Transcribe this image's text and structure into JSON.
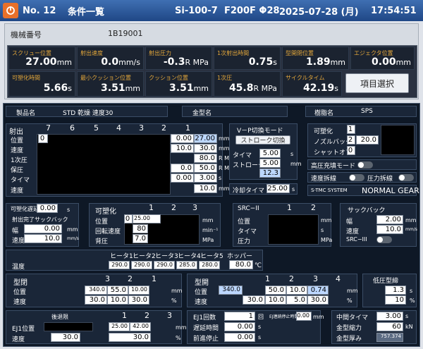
{
  "header": {
    "no": "No. 12",
    "title": "条件一覧",
    "mold": "Si-100-7",
    "spec": "F200F Φ28",
    "date": "2025-07-28 (月)",
    "time": "17:54:51"
  },
  "machine": {
    "label": "機械番号",
    "value": "1B19001"
  },
  "monitor": [
    {
      "label": "スクリュー位置",
      "value": "27.00",
      "unit": "mm"
    },
    {
      "label": "射出速度",
      "value": "0.0",
      "unit": "mm/s"
    },
    {
      "label": "射出圧力",
      "value": "-0.3",
      "unit": "R MPa"
    },
    {
      "label": "1次射出時間",
      "value": "0.75",
      "unit": "s"
    },
    {
      "label": "型開閉位置",
      "value": "1.89",
      "unit": "mm"
    },
    {
      "label": "エジェクタ位置",
      "value": "0.00",
      "unit": "mm"
    },
    {
      "label": "可塑化時間",
      "value": "5.66",
      "unit": "s"
    },
    {
      "label": "最小クッション位置",
      "value": "3.51",
      "unit": "mm"
    },
    {
      "label": "クッション位置",
      "value": "3.51",
      "unit": "mm"
    },
    {
      "label": "1次圧",
      "value": "45.8",
      "unit": "R MPa"
    },
    {
      "label": "サイクルタイム",
      "value": "42.19",
      "unit": "s"
    }
  ],
  "select_button": "項目選択",
  "info": {
    "product_label": "製品名",
    "product_value": "STD 乾燥  速度30",
    "mold_label": "金型名",
    "mold_value": "",
    "resin_label": "樹脂名",
    "resin_value": "SPS"
  },
  "inject": {
    "title": "射出",
    "cols": [
      "7",
      "6",
      "5",
      "4",
      "3",
      "2",
      "1"
    ],
    "rows": [
      "位置",
      "速度",
      "1次圧",
      "保圧",
      "タイマ",
      "速度"
    ],
    "pos0": "0",
    "pos2": "0.00",
    "pos1": "27.00",
    "spd2": "10.0",
    "spd1": "30.0",
    "p1": "80.0",
    "h2": "0.0",
    "h1": "50.0",
    "t2": "0.00",
    "t1": "3.00",
    "v1": "10.0",
    "units": [
      "mm",
      "mm/s",
      "R MPa",
      "R MPa",
      "s",
      "mm/s"
    ]
  },
  "vp": {
    "title": "V－P切換モード",
    "mode": "ストローク切換",
    "timer_label": "タイマ",
    "timer": "5.00",
    "timer_unit": "s",
    "stroke_label": "ストローク",
    "stroke": "5.00",
    "stroke_unit": "mm",
    "extra": "12.3"
  },
  "cool": {
    "label": "冷却タイマ",
    "value": "25.00",
    "unit": "s"
  },
  "plast": {
    "rows": [
      "可塑化",
      "ノズルバック",
      "シャットオフ"
    ],
    "vals": [
      "1",
      "2",
      "0"
    ],
    "mid": "20.0",
    "high_label": "高圧充填モード",
    "high_state": "OFF",
    "spd_label": "速度拆線",
    "spd_state": "OFF",
    "prs_label": "圧力拆線",
    "prs_state": "OFF",
    "tmc_label": "S-TMC SYSTEM",
    "tmc_value": "NORMAL GEAR"
  },
  "delay": {
    "label": "可塑化遅延",
    "value": "0.00",
    "unit": "s",
    "suck_label": "射出完了サックバック",
    "w_label": "幅",
    "w_value": "0.00",
    "w_unit": "mm",
    "s_label": "速度",
    "s_value": "10.0",
    "s_unit": "mm/s"
  },
  "plast2": {
    "title": "可塑化",
    "cols": [
      "1",
      "2",
      "3"
    ],
    "rows": [
      "位置",
      "回転速度",
      "背圧"
    ],
    "pos0": "0",
    "pos1": "25.00",
    "rpm": "80",
    "bp": "7.0",
    "u1": "mm",
    "u2": "min⁻¹",
    "u3": "MPa"
  },
  "src": {
    "title": "SRC−II",
    "cols": [
      "1",
      "2"
    ],
    "rows": [
      "位置",
      "タイマ",
      "圧力"
    ],
    "u1": "mm",
    "u2": "s",
    "u3": "MPa"
  },
  "suck": {
    "title": "サックバック",
    "rows": [
      "幅",
      "速度",
      "SRC−III"
    ],
    "w": "2.00",
    "s": "10.0",
    "u1": "mm",
    "u2": "mm/s",
    "state": "OFF"
  },
  "heater": {
    "labels": [
      "ヒータ1",
      "ヒータ2",
      "ヒータ3",
      "ヒータ4",
      "ヒータ5",
      "ホッパー"
    ],
    "row_label": "温度",
    "vals": [
      "290.0",
      "290.0",
      "290.0",
      "285.0",
      "280.0",
      "80.0"
    ],
    "unit": "℃"
  },
  "close": {
    "title": "型閉",
    "cols": [
      "3",
      "2",
      "1"
    ],
    "pos_label": "位置",
    "spd_label": "速度",
    "p3": "340.0",
    "p2": "55.0",
    "p1": "10.00",
    "s3": "30.0",
    "s2": "10.0",
    "s1": "30.0",
    "u1": "mm",
    "u2": "%"
  },
  "open": {
    "title": "型開",
    "cols": [
      "1",
      "2",
      "3",
      "4"
    ],
    "pos_label": "位置",
    "spd_label": "速度",
    "p1": "340.0",
    "p2": "50.0",
    "p3": "10.0",
    "p4": "0.74",
    "s1": "30.0",
    "s2": "10.0",
    "s3": "5.0",
    "s4": "30.0",
    "u1": "mm",
    "u2": "%"
  },
  "lowp": {
    "title": "低圧型締",
    "v1": "1.3",
    "u1": "s",
    "v2": "10",
    "u2": "%"
  },
  "ej": {
    "title": "後退限",
    "cols": [
      "1",
      "2",
      "3"
    ],
    "pos_label": "EJ1位置",
    "spd_label": "速度",
    "p1": "25.00",
    "p2": "42.00",
    "u1": "mm",
    "s0": "30.0",
    "s1": "30.0",
    "u2": "%"
  },
  "ejcnt": {
    "rows": [
      "EJ1回数",
      "遅延時間",
      "前進停止"
    ],
    "vals": [
      "1",
      "0.00",
      "0.00"
    ],
    "units": [
      "回",
      "s",
      "s"
    ],
    "side_label": "EJ連続停止時間",
    "side_value": "0.00",
    "side_unit": "mm"
  },
  "tail": {
    "rows": [
      "中間タイマ",
      "金型縮力",
      "金型厚み"
    ],
    "vals": [
      "3.00",
      "60",
      "757.374"
    ],
    "units": [
      "s",
      "kN",
      ""
    ]
  }
}
